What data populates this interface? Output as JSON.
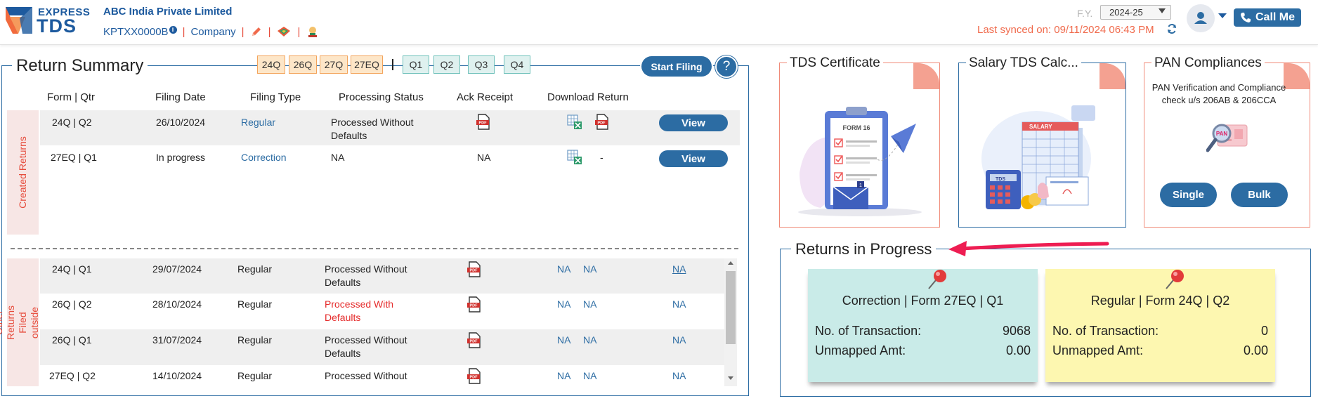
{
  "header": {
    "logo_top": "EXPRESS",
    "logo_bottom": "TDS",
    "company_name": "ABC India Private Limited",
    "tan": "KPTXX0000B",
    "entity_type": "Company",
    "fy_label": "F.Y.",
    "fy_value": "2024-25",
    "last_synced": "Last synced on: 09/11/2024 06:43 PM",
    "call_me": "Call Me"
  },
  "return_summary": {
    "title": "Return Summary",
    "form_tabs": [
      "24Q",
      "26Q",
      "27Q",
      "27EQ"
    ],
    "quarter_tabs": [
      "Q1",
      "Q2",
      "Q3",
      "Q4"
    ],
    "start_filing": "Start Filing",
    "help": "?",
    "columns": [
      "Form | Qtr",
      "Filing Date",
      "Filing Type",
      "Processing Status",
      "Ack Receipt",
      "Download Return"
    ],
    "created_label": "Created Returns",
    "created_rows": [
      {
        "form": "24Q | Q2",
        "date": "26/10/2024",
        "type": "Regular",
        "status": "Processed Without Defaults",
        "ack": "",
        "download_extra": "",
        "action": "View"
      },
      {
        "form": "27EQ | Q1",
        "date": "In progress",
        "type": "Correction",
        "status": "NA",
        "ack": "NA",
        "download_extra": "-",
        "action": "View"
      }
    ],
    "other_label": "Other Returns Filed outside ExpressTDS",
    "other_rows": [
      {
        "form": "24Q | Q1",
        "date": "29/07/2024",
        "type": "Regular",
        "status": "Processed Without Defaults",
        "d1": "NA",
        "d2": "NA",
        "d3": "NA"
      },
      {
        "form": "26Q | Q2",
        "date": "28/10/2024",
        "type": "Regular",
        "status": "Processed With Defaults",
        "d1": "NA",
        "d2": "NA",
        "d3": "NA"
      },
      {
        "form": "26Q | Q1",
        "date": "31/07/2024",
        "type": "Regular",
        "status": "Processed Without Defaults",
        "d1": "NA",
        "d2": "NA",
        "d3": "NA"
      },
      {
        "form": "27EQ | Q2",
        "date": "14/10/2024",
        "type": "Regular",
        "status": "Processed Without",
        "d1": "NA",
        "d2": "NA",
        "d3": "NA"
      }
    ]
  },
  "cards": {
    "tds_certificate": {
      "title": "TDS Certificate",
      "form_label": "FORM 16"
    },
    "salary_calc": {
      "title": "Salary TDS Calc...",
      "salary_label": "SALARY",
      "tds_label": "TDS"
    },
    "pan": {
      "title": "PAN Compliances",
      "desc": "PAN Verification and Compliance check u/s 206AB & 206CCA",
      "single": "Single",
      "bulk": "Bulk",
      "badge": "PAN"
    }
  },
  "returns_in_progress": {
    "title": "Returns in Progress",
    "notes": [
      {
        "title": "Correction | Form 27EQ | Q1",
        "tx_label": "No. of Transaction:",
        "tx": "9068",
        "amt_label": "Unmapped Amt:",
        "amt": "0.00"
      },
      {
        "title": "Regular | Form 24Q | Q2",
        "tx_label": "No. of Transaction:",
        "tx": "0",
        "amt_label": "Unmapped Amt:",
        "amt": "0.00"
      }
    ]
  },
  "colors": {
    "primary": "#2c6ca3",
    "accent": "#e64c3c",
    "teal_note": "#c9ebe8",
    "yellow_note": "#fdf7b0",
    "form_tab": "#fde6c8",
    "qtr_tab": "#dff1ef"
  },
  "icons": [
    "edit-icon",
    "refresh-icon",
    "user-icon",
    "phone-icon",
    "pdf-icon",
    "excel-icon",
    "pin-icon"
  ]
}
